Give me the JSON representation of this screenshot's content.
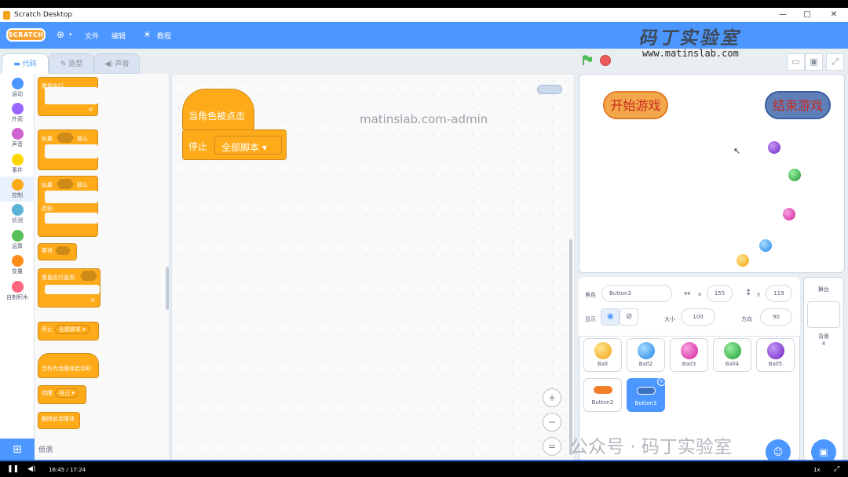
{
  "titlebar": {
    "title": "Scratch Desktop",
    "minimize": "—",
    "maximize": "□",
    "close": "✕"
  },
  "menubar": {
    "logo": "SCRATCH",
    "language_icon": "globe-icon",
    "file": "文件",
    "edit": "编辑",
    "tutorials": "教程"
  },
  "watermarks": {
    "brand": "码丁实验室",
    "url": "www.matinslab.com",
    "admin": "matinslab.com-admin",
    "wechat": "公众号 · 码丁实验室"
  },
  "tabs": [
    {
      "label": "代码"
    },
    {
      "label": "造型"
    },
    {
      "label": "声音"
    }
  ],
  "categories": [
    {
      "label": "运动",
      "color": "#4c97ff"
    },
    {
      "label": "外观",
      "color": "#9966ff"
    },
    {
      "label": "声音",
      "color": "#cf63cf"
    },
    {
      "label": "事件",
      "color": "#ffd500"
    },
    {
      "label": "控制",
      "color": "#ffab19"
    },
    {
      "label": "侦测",
      "color": "#5cb1d6"
    },
    {
      "label": "运算",
      "color": "#59c059"
    },
    {
      "label": "变量",
      "color": "#ff8c1a"
    },
    {
      "label": "自制积木",
      "color": "#ff6680"
    }
  ],
  "palette": {
    "forever": "重复执行",
    "if_then_if": "如果",
    "if_then_then": "那么",
    "if_else_if": "如果",
    "if_else_then": "那么",
    "if_else_else": "否则",
    "wait_until": "等待",
    "repeat_until": "重复执行直到",
    "stop": "停止",
    "stop_option": "全部脚本",
    "when_clone": "当作为克隆体启动时",
    "clone": "克隆",
    "clone_option": "自己",
    "delete_clone": "删除此克隆体",
    "next_category": "侦测"
  },
  "script": {
    "hat": "当角色被点击",
    "stop": "停止",
    "stop_option": "全部脚本"
  },
  "zoom": {
    "in": "+",
    "out": "−",
    "reset": "="
  },
  "stage": {
    "start_button": "开始游戏",
    "end_button": "结束游戏"
  },
  "sprite_info": {
    "sprite_label": "角色",
    "sprite_name": "Button3",
    "x_label": "x",
    "x": "155",
    "y_label": "y",
    "y": "119",
    "show_label": "显示",
    "size_label": "大小",
    "size": "100",
    "direction_label": "方向",
    "direction": "90"
  },
  "sprites": [
    {
      "name": "Ball",
      "color": "#f7b51e"
    },
    {
      "name": "Ball2",
      "color": "#2a9df4"
    },
    {
      "name": "Ball3",
      "color": "#e534b5"
    },
    {
      "name": "Ball4",
      "color": "#2fb84a"
    },
    {
      "name": "Ball5",
      "color": "#7a2fd8"
    },
    {
      "name": "Button2",
      "color": "#f27f2a"
    },
    {
      "name": "Button3",
      "color": "#3a72c4"
    }
  ],
  "stage_pane": {
    "title": "舞台",
    "backdrops_label": "背景",
    "backdrops_count": "4"
  },
  "player": {
    "time": "16:45 / 17:24",
    "speed": "1x"
  }
}
